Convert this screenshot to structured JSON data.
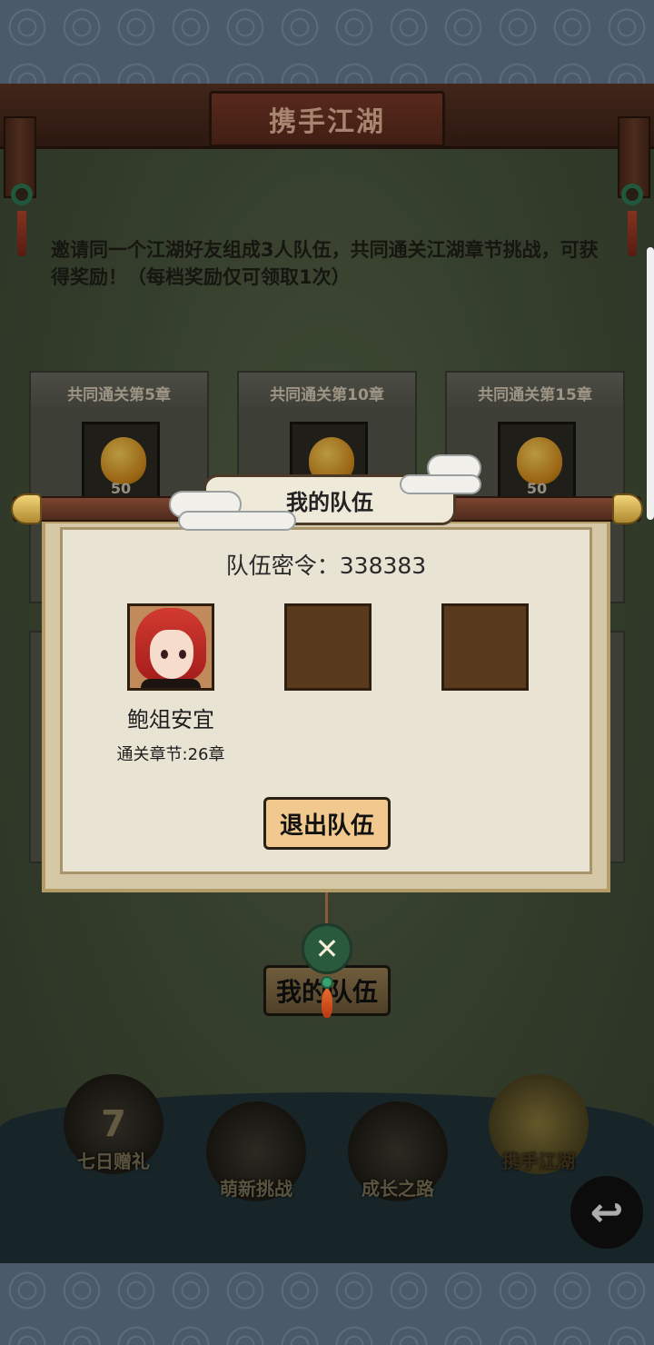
{
  "header": {
    "title": "携手江湖"
  },
  "description": "邀请同一个江湖好友组成3人队伍，共同通关江湖章节挑战，可获得奖励！（每档奖励仅可领取1次）",
  "reward_cards": [
    {
      "label": "共同通关第5章",
      "count": "50"
    },
    {
      "label": "共同通关第10章",
      "count": "50"
    },
    {
      "label": "共同通关第15章",
      "count": "50"
    }
  ],
  "my_team_button": "我的队伍",
  "bottom_nav": [
    {
      "label": "七日赠礼",
      "glyph": "7",
      "icon": "gift-box-icon"
    },
    {
      "label": "萌新挑战",
      "glyph": "",
      "icon": "monster-face-icon"
    },
    {
      "label": "成长之路",
      "glyph": "",
      "icon": "book-arrow-icon"
    },
    {
      "label": "携手江湖",
      "glyph": "",
      "icon": "handshake-icon",
      "active": true
    }
  ],
  "back_button": "back-arrow-icon",
  "modal": {
    "title": "我的队伍",
    "password_label": "队伍密令：",
    "password_value": "338383",
    "member": {
      "name": "鲍俎安宜",
      "chapter": "通关章节:26章"
    },
    "leave_button": "退出队伍",
    "close_icon": "crossed-swords-icon"
  },
  "colors": {
    "panel_bg": "#e9e3d4",
    "button_bg": "#f1c98e",
    "empty_slot": "#5a3a1c",
    "close_btn": "#2a5a3e"
  }
}
